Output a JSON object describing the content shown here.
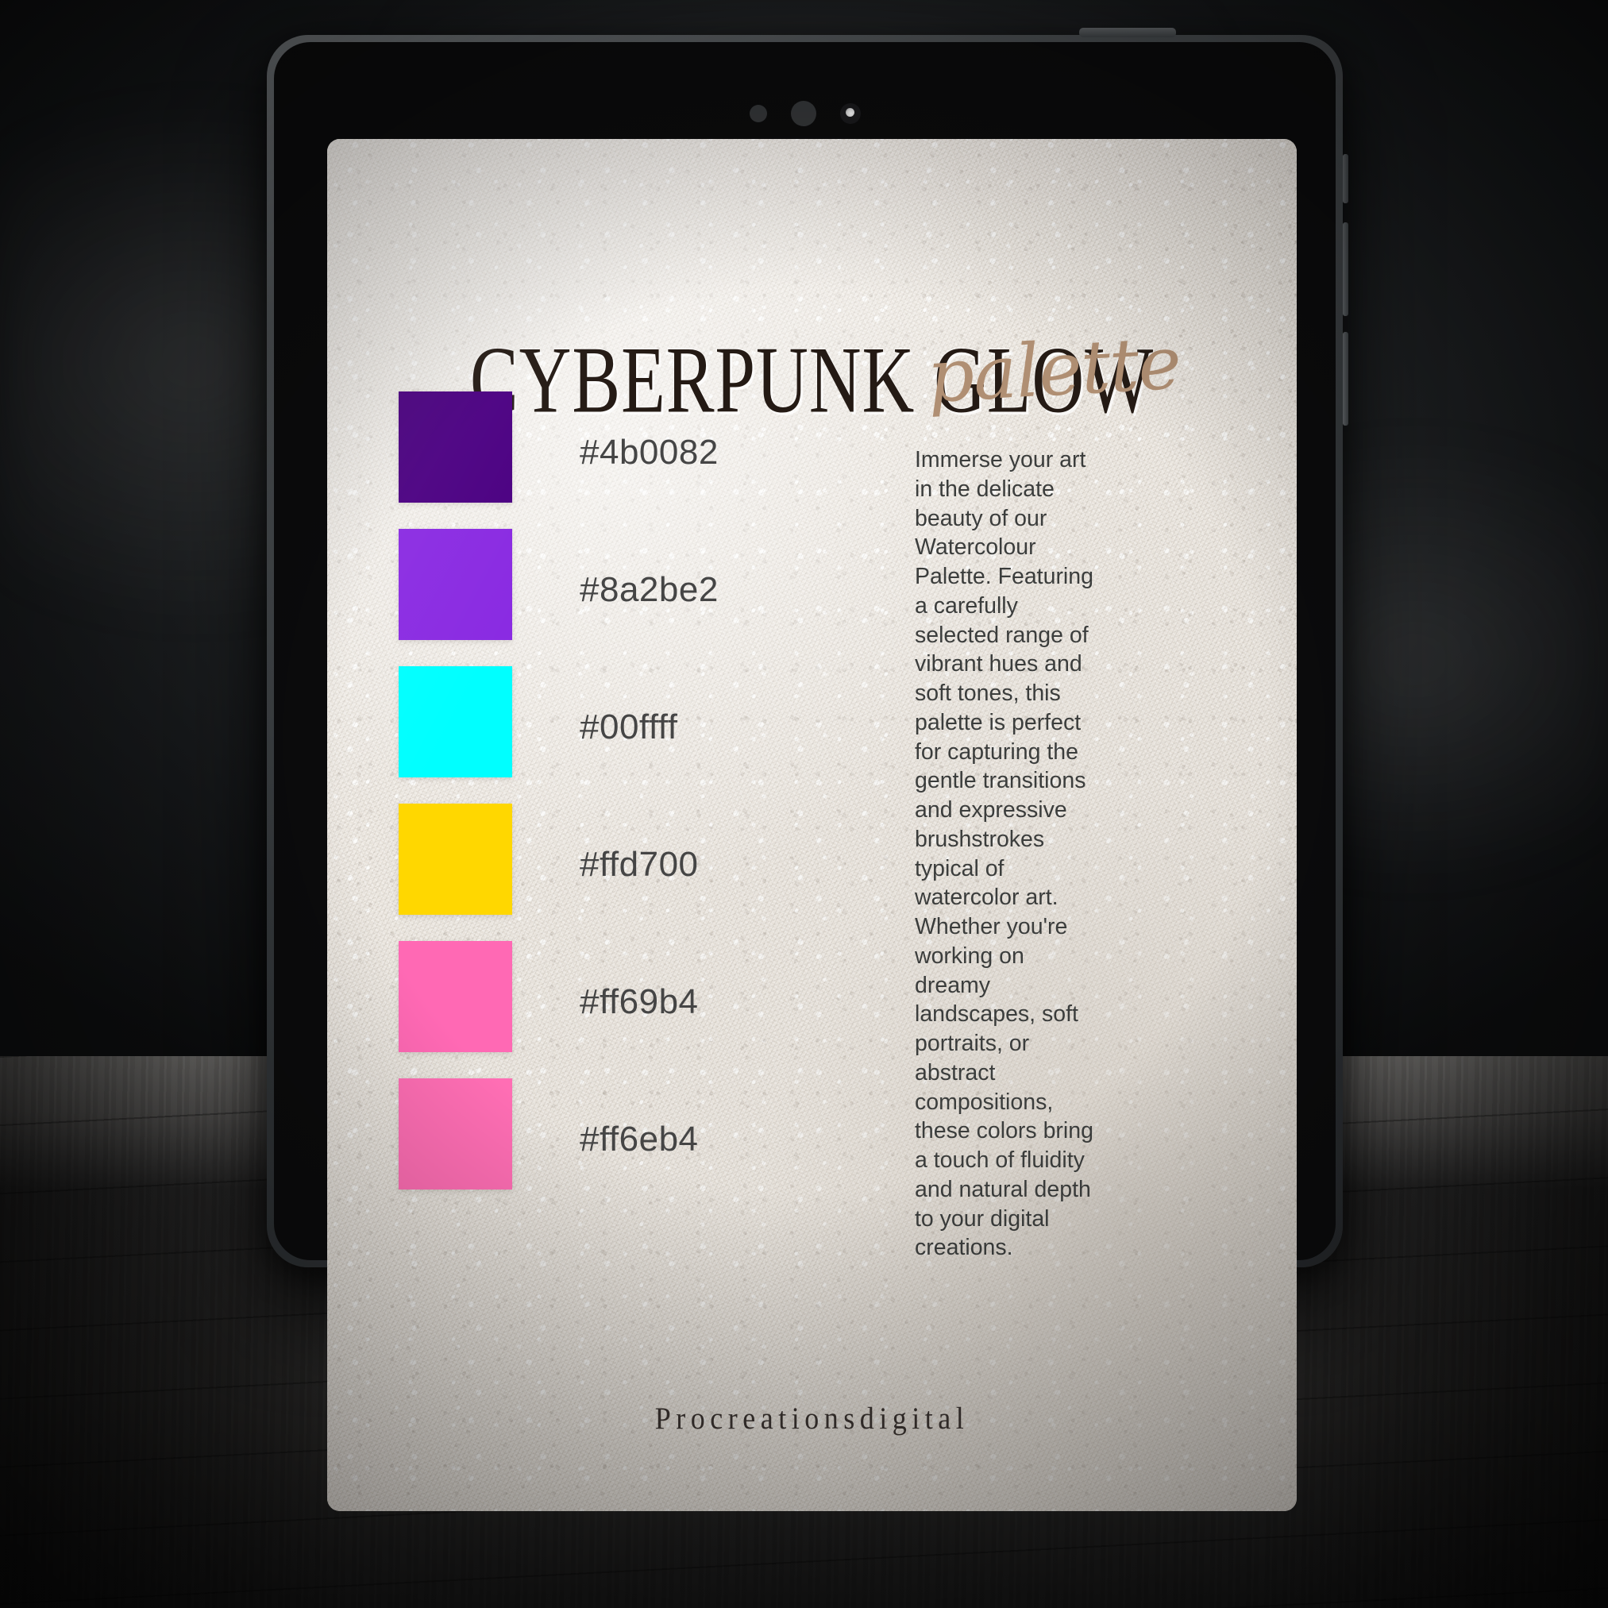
{
  "device": {
    "type": "tablet",
    "cameras": [
      "camera-lens-small",
      "camera-lens-large",
      "camera-flash"
    ]
  },
  "card": {
    "title": "CYBERPUNK GLOW",
    "script_word": "palette",
    "background_color": "#eee9e1",
    "accent_color": "#b08f73",
    "text_color": "#3b3d3c",
    "description": "Immerse your art in the delicate beauty of our Watercolour Palette. Featuring a carefully selected range of vibrant hues and soft tones, this palette is perfect for capturing the gentle transitions and expressive brushstrokes typical of watercolor art. Whether you're working on dreamy landscapes, soft portraits, or abstract compositions, these colors bring a touch of fluidity and natural depth to your digital creations.",
    "footer": "Procreationsdigital"
  },
  "swatches": [
    {
      "hex": "#4b0082",
      "label": "#4b0082"
    },
    {
      "hex": "#8a2be2",
      "label": "#8a2be2"
    },
    {
      "hex": "#00ffff",
      "label": "#00ffff"
    },
    {
      "hex": "#ffd700",
      "label": "#ffd700"
    },
    {
      "hex": "#ff69b4",
      "label": "#ff69b4"
    },
    {
      "hex": "#ff6eb4",
      "label": "#ff6eb4"
    }
  ]
}
